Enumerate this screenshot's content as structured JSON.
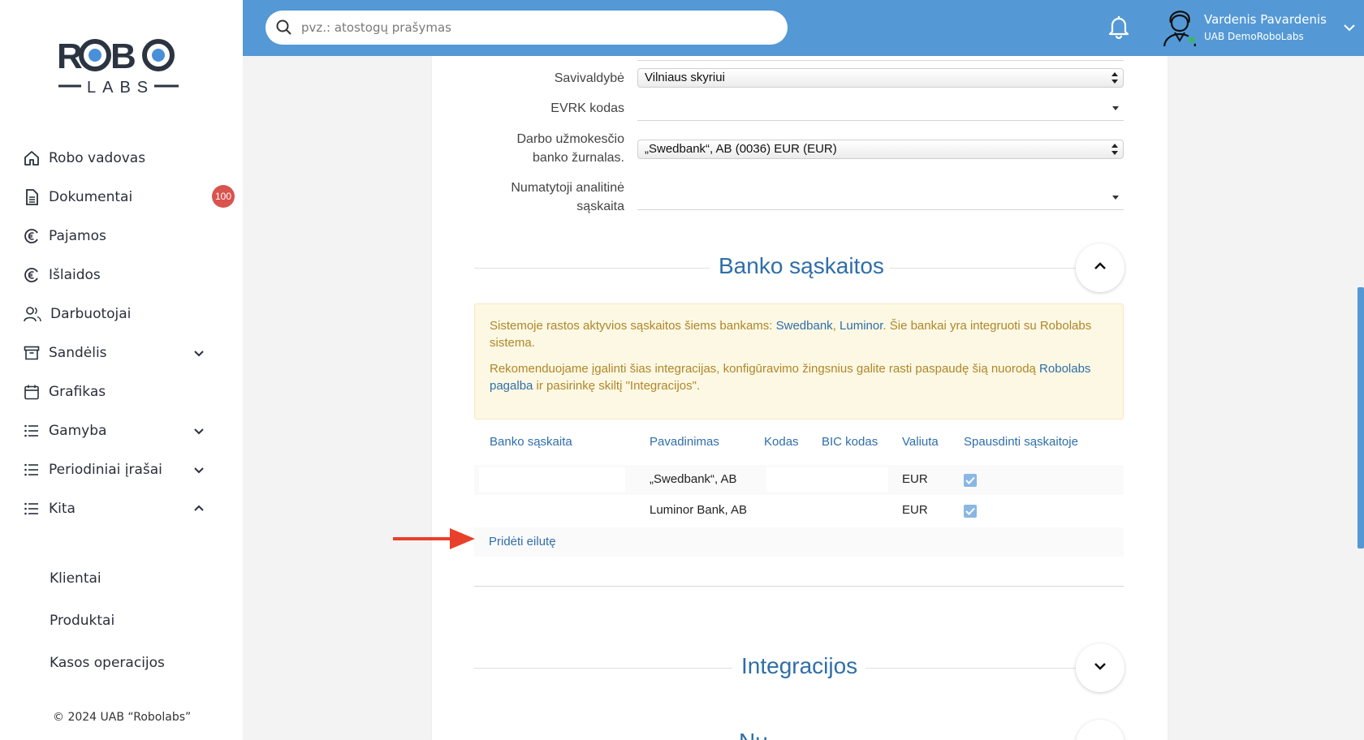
{
  "brand": {
    "logo_text": "ROBO",
    "logo_sub": "LABS",
    "accent": "#5499d6",
    "badge_color": "#d9534f"
  },
  "sidebar": {
    "items": [
      {
        "label": "Robo vadovas",
        "icon": "home-icon"
      },
      {
        "label": "Dokumentai",
        "icon": "document-icon",
        "badge": "100"
      },
      {
        "label": "Pajamos",
        "icon": "euro-coin-icon"
      },
      {
        "label": "Išlaidos",
        "icon": "euro-coin-icon"
      },
      {
        "label": "Darbuotojai",
        "icon": "users-icon"
      },
      {
        "label": "Sandėlis",
        "icon": "archive-icon",
        "expand": "chevron-down-icon"
      },
      {
        "label": "Grafikas",
        "icon": "calendar-icon"
      },
      {
        "label": "Gamyba",
        "icon": "list-icon",
        "expand": "chevron-down-icon"
      },
      {
        "label": "Periodiniai įrašai",
        "icon": "list-icon",
        "expand": "chevron-down-icon"
      },
      {
        "label": "Kita",
        "icon": "list-icon",
        "expand": "chevron-up-icon"
      }
    ],
    "subitems": [
      "Klientai",
      "Produktai",
      "Kasos operacijos"
    ],
    "copyright": "© 2024 UAB “Robolabs”"
  },
  "header": {
    "search_placeholder": "pvz.: atostogų prašymas",
    "user_name": "Vardenis Pavardenis",
    "user_company": "UAB DemoRoboLabs"
  },
  "form": {
    "savivaldybe_label": "Savivaldybė",
    "savivaldybe_value": "Vilniaus skyriui",
    "evrk_label": "EVRK kodas",
    "evrk_value": "",
    "journal_label_1": "Darbo užmokesčio",
    "journal_label_2": "banko žurnalas.",
    "journal_value": "„Swedbank“, AB (0036) EUR (EUR)",
    "analytic_label_1": "Numatytoji analitinė",
    "analytic_label_2": "sąskaita",
    "analytic_value": ""
  },
  "bank_section": {
    "title": "Banko sąskaitos",
    "alert_p1_a": "Sistemoje rastos aktyvios sąskaitos šiems bankams: ",
    "alert_p1_link1": "Swedbank",
    "alert_p1_sep": ", ",
    "alert_p1_link2": "Luminor",
    "alert_p1_b": ". Šie bankai yra integruoti su Robolabs sistema.",
    "alert_p2_a": "Rekomenduojame įgalinti šias integracijas, konfigūravimo žingsnius galite rasti paspaudę šią nuorodą ",
    "alert_p2_link": "Robolabs pagalba",
    "alert_p2_b": " ir pasirinkę skiltį \"Integracijos\".",
    "columns": [
      "Banko sąskaita",
      "Pavadinimas",
      "Kodas",
      "BIC kodas",
      "Valiuta",
      "Spausdinti sąskaitoje"
    ],
    "rows": [
      {
        "account": "",
        "name": "„Swedbank“, AB",
        "code": "",
        "bic": "",
        "currency": "EUR",
        "print": true
      },
      {
        "account": "",
        "name": "Luminor Bank, AB",
        "code": "",
        "bic": "",
        "currency": "EUR",
        "print": true
      }
    ],
    "add_row": "Pridėti eilutę"
  },
  "integrations_section": {
    "title": "Integracijos"
  },
  "next_section": {
    "title": "Nu..."
  }
}
